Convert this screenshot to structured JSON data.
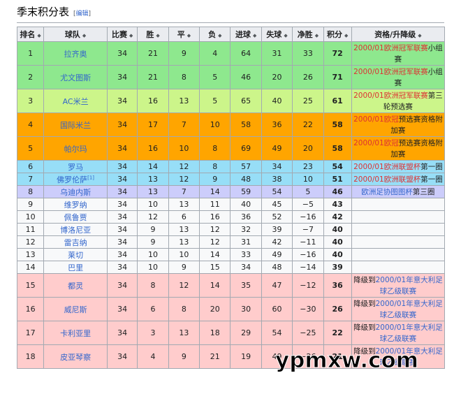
{
  "heading": {
    "title": "季末积分表",
    "edit_open": "[",
    "edit_label": "编辑",
    "edit_close": "]"
  },
  "columns": [
    "排名",
    "球队",
    "比赛",
    "胜",
    "平",
    "负",
    "进球",
    "失球",
    "净胜",
    "积分",
    "资格/升降级"
  ],
  "rows": [
    {
      "rank": "1",
      "team": "拉齐奥",
      "played": "34",
      "won": "21",
      "drawn": "9",
      "lost": "4",
      "gf": "64",
      "ga": "31",
      "gd": "33",
      "pts": "72",
      "qual_link": "2000/01欧洲冠军联赛",
      "qual_text": "小组赛",
      "qual_link_color": "red",
      "band": "green",
      "height": "tall"
    },
    {
      "rank": "2",
      "team": "尤文图斯",
      "played": "34",
      "won": "21",
      "drawn": "8",
      "lost": "5",
      "gf": "46",
      "ga": "20",
      "gd": "26",
      "pts": "71",
      "qual_link": "2000/01欧洲冠军联赛",
      "qual_text": "小组赛",
      "qual_link_color": "red",
      "band": "green",
      "height": "tall"
    },
    {
      "rank": "3",
      "team": "AC米兰",
      "played": "34",
      "won": "16",
      "drawn": "13",
      "lost": "5",
      "gf": "65",
      "ga": "40",
      "gd": "25",
      "pts": "61",
      "qual_link": "2000/01欧洲冠军联赛",
      "qual_text": "第三轮预选赛",
      "qual_link_color": "red",
      "band": "lime",
      "height": "tall"
    },
    {
      "rank": "4",
      "team": "国际米兰",
      "played": "34",
      "won": "17",
      "drawn": "7",
      "lost": "10",
      "gf": "58",
      "ga": "36",
      "gd": "22",
      "pts": "58",
      "qual_link": "2000/01欧冠",
      "qual_text": "预选赛资格附加赛",
      "qual_link_color": "red",
      "band": "orange",
      "height": "tall"
    },
    {
      "rank": "5",
      "team": "帕尔玛",
      "played": "34",
      "won": "16",
      "drawn": "10",
      "lost": "8",
      "gf": "69",
      "ga": "49",
      "gd": "20",
      "pts": "58",
      "qual_link": "2000/01欧冠",
      "qual_text": "预选赛资格附加赛",
      "qual_link_color": "red",
      "band": "orange",
      "height": "tall"
    },
    {
      "rank": "6",
      "team": "罗马",
      "team_sup": "",
      "played": "34",
      "won": "14",
      "drawn": "12",
      "lost": "8",
      "gf": "57",
      "ga": "34",
      "gd": "23",
      "pts": "54",
      "qual_link": "2000/01欧洲联盟杯",
      "qual_text": "第一圈",
      "qual_link_color": "red",
      "band": "cyan",
      "height": "med"
    },
    {
      "rank": "7",
      "team": "佛罗伦萨",
      "team_sup": "[1]",
      "played": "34",
      "won": "13",
      "drawn": "12",
      "lost": "9",
      "gf": "48",
      "ga": "38",
      "gd": "10",
      "pts": "51",
      "qual_link": "2000/01欧洲联盟杯",
      "qual_text": "第一圈",
      "qual_link_color": "red",
      "band": "cyan",
      "height": "med"
    },
    {
      "rank": "8",
      "team": "乌迪内斯",
      "played": "34",
      "won": "13",
      "drawn": "7",
      "lost": "14",
      "gf": "59",
      "ga": "54",
      "gd": "5",
      "pts": "46",
      "qual_link": "欧洲足协图图杯",
      "qual_text": "第三圈",
      "qual_link_color": "blue",
      "band": "lav",
      "height": "med"
    },
    {
      "rank": "9",
      "team": "维罗纳",
      "played": "34",
      "won": "10",
      "drawn": "13",
      "lost": "11",
      "gf": "40",
      "ga": "45",
      "gd": "−5",
      "pts": "43",
      "qual_link": "",
      "qual_text": "",
      "band": "white",
      "height": "med"
    },
    {
      "rank": "10",
      "team": "佩鲁贾",
      "played": "34",
      "won": "12",
      "drawn": "6",
      "lost": "16",
      "gf": "36",
      "ga": "52",
      "gd": "−16",
      "pts": "42",
      "qual_link": "",
      "qual_text": "",
      "band": "white",
      "height": "med"
    },
    {
      "rank": "11",
      "team": "博洛尼亚",
      "played": "34",
      "won": "9",
      "drawn": "13",
      "lost": "12",
      "gf": "32",
      "ga": "39",
      "gd": "−7",
      "pts": "40",
      "qual_link": "",
      "qual_text": "",
      "band": "white",
      "height": "med"
    },
    {
      "rank": "12",
      "team": "雷吉纳",
      "played": "34",
      "won": "9",
      "drawn": "13",
      "lost": "12",
      "gf": "31",
      "ga": "42",
      "gd": "−11",
      "pts": "40",
      "qual_link": "",
      "qual_text": "",
      "band": "white",
      "height": "med"
    },
    {
      "rank": "13",
      "team": "莱切",
      "played": "34",
      "won": "10",
      "drawn": "10",
      "lost": "14",
      "gf": "33",
      "ga": "49",
      "gd": "−16",
      "pts": "40",
      "qual_link": "",
      "qual_text": "",
      "band": "white",
      "height": "med"
    },
    {
      "rank": "14",
      "team": "巴里",
      "played": "34",
      "won": "10",
      "drawn": "9",
      "lost": "15",
      "gf": "34",
      "ga": "48",
      "gd": "−14",
      "pts": "39",
      "qual_link": "",
      "qual_text": "",
      "band": "white",
      "height": "med"
    },
    {
      "rank": "15",
      "team": "都灵",
      "played": "34",
      "won": "8",
      "drawn": "12",
      "lost": "14",
      "gf": "35",
      "ga": "47",
      "gd": "−12",
      "pts": "36",
      "qual_pre": "降级到",
      "qual_link": "2000/01年意大利足球乙级联赛",
      "qual_text": "",
      "qual_link_color": "blue",
      "band": "pink",
      "height": "tall"
    },
    {
      "rank": "16",
      "team": "威尼斯",
      "played": "34",
      "won": "6",
      "drawn": "8",
      "lost": "20",
      "gf": "30",
      "ga": "60",
      "gd": "−30",
      "pts": "26",
      "qual_pre": "降级到",
      "qual_link": "2000/01年意大利足球乙级联赛",
      "qual_text": "",
      "qual_link_color": "blue",
      "band": "pink",
      "height": "tall"
    },
    {
      "rank": "17",
      "team": "卡利亚里",
      "played": "34",
      "won": "3",
      "drawn": "13",
      "lost": "18",
      "gf": "29",
      "ga": "54",
      "gd": "−25",
      "pts": "22",
      "qual_pre": "降级到",
      "qual_link": "2000/01年意大利足球乙级联赛",
      "qual_text": "",
      "qual_link_color": "blue",
      "band": "pink",
      "height": "tall"
    },
    {
      "rank": "18",
      "team": "皮亚琴察",
      "played": "34",
      "won": "4",
      "drawn": "9",
      "lost": "21",
      "gf": "19",
      "ga": "49",
      "gd": "−26",
      "pts": "21",
      "qual_pre": "降级到",
      "qual_link": "2000/01年意大利足球乙级联赛",
      "qual_text": "",
      "qual_link_color": "blue",
      "band": "pink",
      "height": "tall"
    }
  ],
  "watermark": "ypmxw.com",
  "colors": {
    "green": "#8ee88e",
    "lime": "#ccf58a",
    "orange": "#ffa500",
    "cyan": "#97def7",
    "lavender": "#cccdfb",
    "pink": "#ffcccc",
    "link_red": "#dd3333",
    "link_blue": "#3366cc",
    "header_bg": "#eaecf0"
  }
}
